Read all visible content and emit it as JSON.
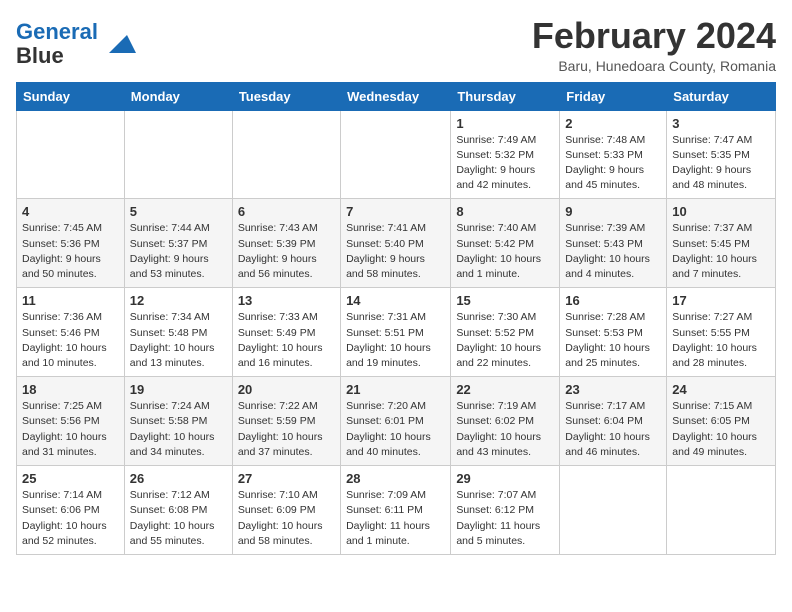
{
  "logo": {
    "line1": "General",
    "line2": "Blue"
  },
  "title": "February 2024",
  "subtitle": "Baru, Hunedoara County, Romania",
  "days_header": [
    "Sunday",
    "Monday",
    "Tuesday",
    "Wednesday",
    "Thursday",
    "Friday",
    "Saturday"
  ],
  "weeks": [
    [
      {
        "day": "",
        "info": ""
      },
      {
        "day": "",
        "info": ""
      },
      {
        "day": "",
        "info": ""
      },
      {
        "day": "",
        "info": ""
      },
      {
        "day": "1",
        "info": "Sunrise: 7:49 AM\nSunset: 5:32 PM\nDaylight: 9 hours\nand 42 minutes."
      },
      {
        "day": "2",
        "info": "Sunrise: 7:48 AM\nSunset: 5:33 PM\nDaylight: 9 hours\nand 45 minutes."
      },
      {
        "day": "3",
        "info": "Sunrise: 7:47 AM\nSunset: 5:35 PM\nDaylight: 9 hours\nand 48 minutes."
      }
    ],
    [
      {
        "day": "4",
        "info": "Sunrise: 7:45 AM\nSunset: 5:36 PM\nDaylight: 9 hours\nand 50 minutes."
      },
      {
        "day": "5",
        "info": "Sunrise: 7:44 AM\nSunset: 5:37 PM\nDaylight: 9 hours\nand 53 minutes."
      },
      {
        "day": "6",
        "info": "Sunrise: 7:43 AM\nSunset: 5:39 PM\nDaylight: 9 hours\nand 56 minutes."
      },
      {
        "day": "7",
        "info": "Sunrise: 7:41 AM\nSunset: 5:40 PM\nDaylight: 9 hours\nand 58 minutes."
      },
      {
        "day": "8",
        "info": "Sunrise: 7:40 AM\nSunset: 5:42 PM\nDaylight: 10 hours\nand 1 minute."
      },
      {
        "day": "9",
        "info": "Sunrise: 7:39 AM\nSunset: 5:43 PM\nDaylight: 10 hours\nand 4 minutes."
      },
      {
        "day": "10",
        "info": "Sunrise: 7:37 AM\nSunset: 5:45 PM\nDaylight: 10 hours\nand 7 minutes."
      }
    ],
    [
      {
        "day": "11",
        "info": "Sunrise: 7:36 AM\nSunset: 5:46 PM\nDaylight: 10 hours\nand 10 minutes."
      },
      {
        "day": "12",
        "info": "Sunrise: 7:34 AM\nSunset: 5:48 PM\nDaylight: 10 hours\nand 13 minutes."
      },
      {
        "day": "13",
        "info": "Sunrise: 7:33 AM\nSunset: 5:49 PM\nDaylight: 10 hours\nand 16 minutes."
      },
      {
        "day": "14",
        "info": "Sunrise: 7:31 AM\nSunset: 5:51 PM\nDaylight: 10 hours\nand 19 minutes."
      },
      {
        "day": "15",
        "info": "Sunrise: 7:30 AM\nSunset: 5:52 PM\nDaylight: 10 hours\nand 22 minutes."
      },
      {
        "day": "16",
        "info": "Sunrise: 7:28 AM\nSunset: 5:53 PM\nDaylight: 10 hours\nand 25 minutes."
      },
      {
        "day": "17",
        "info": "Sunrise: 7:27 AM\nSunset: 5:55 PM\nDaylight: 10 hours\nand 28 minutes."
      }
    ],
    [
      {
        "day": "18",
        "info": "Sunrise: 7:25 AM\nSunset: 5:56 PM\nDaylight: 10 hours\nand 31 minutes."
      },
      {
        "day": "19",
        "info": "Sunrise: 7:24 AM\nSunset: 5:58 PM\nDaylight: 10 hours\nand 34 minutes."
      },
      {
        "day": "20",
        "info": "Sunrise: 7:22 AM\nSunset: 5:59 PM\nDaylight: 10 hours\nand 37 minutes."
      },
      {
        "day": "21",
        "info": "Sunrise: 7:20 AM\nSunset: 6:01 PM\nDaylight: 10 hours\nand 40 minutes."
      },
      {
        "day": "22",
        "info": "Sunrise: 7:19 AM\nSunset: 6:02 PM\nDaylight: 10 hours\nand 43 minutes."
      },
      {
        "day": "23",
        "info": "Sunrise: 7:17 AM\nSunset: 6:04 PM\nDaylight: 10 hours\nand 46 minutes."
      },
      {
        "day": "24",
        "info": "Sunrise: 7:15 AM\nSunset: 6:05 PM\nDaylight: 10 hours\nand 49 minutes."
      }
    ],
    [
      {
        "day": "25",
        "info": "Sunrise: 7:14 AM\nSunset: 6:06 PM\nDaylight: 10 hours\nand 52 minutes."
      },
      {
        "day": "26",
        "info": "Sunrise: 7:12 AM\nSunset: 6:08 PM\nDaylight: 10 hours\nand 55 minutes."
      },
      {
        "day": "27",
        "info": "Sunrise: 7:10 AM\nSunset: 6:09 PM\nDaylight: 10 hours\nand 58 minutes."
      },
      {
        "day": "28",
        "info": "Sunrise: 7:09 AM\nSunset: 6:11 PM\nDaylight: 11 hours\nand 1 minute."
      },
      {
        "day": "29",
        "info": "Sunrise: 7:07 AM\nSunset: 6:12 PM\nDaylight: 11 hours\nand 5 minutes."
      },
      {
        "day": "",
        "info": ""
      },
      {
        "day": "",
        "info": ""
      }
    ]
  ]
}
